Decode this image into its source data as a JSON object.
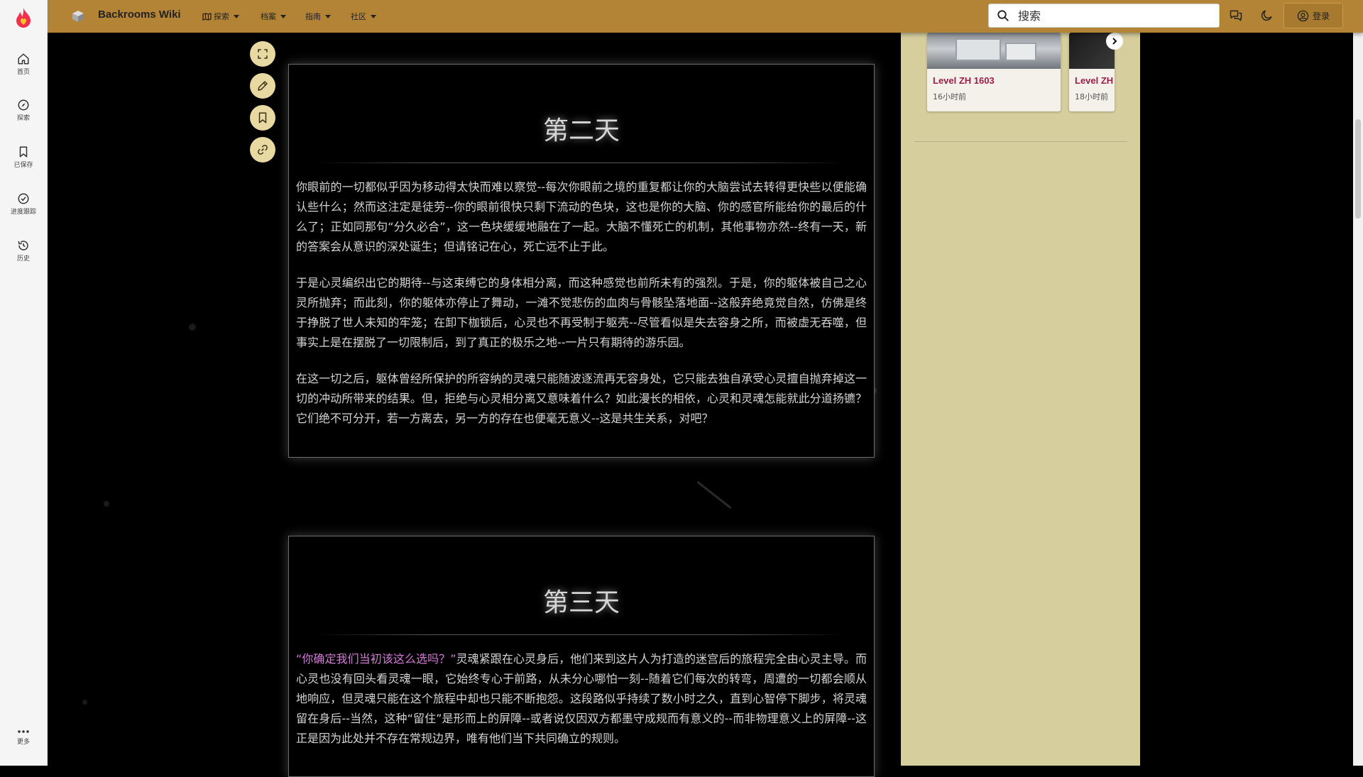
{
  "rail": {
    "items": [
      {
        "label": "首页",
        "icon": "home-icon"
      },
      {
        "label": "探索",
        "icon": "compass-icon"
      },
      {
        "label": "已保存",
        "icon": "bookmark-icon"
      },
      {
        "label": "进度跟踪",
        "icon": "check-circle-icon"
      },
      {
        "label": "历史",
        "icon": "history-icon"
      }
    ],
    "more_label": "更多"
  },
  "topbar": {
    "site_name": "Backrooms Wiki",
    "nav": [
      {
        "label": "探索"
      },
      {
        "label": "档案"
      },
      {
        "label": "指南"
      },
      {
        "label": "社区"
      }
    ],
    "search_placeholder": "搜索",
    "login_label": "登录"
  },
  "article": {
    "day2": {
      "title": "第二天",
      "paragraphs": [
        "你眼前的一切都似乎因为移动得太快而难以察觉--每次你眼前之境的重复都让你的大脑尝试去转得更快些以便能确认些什么；然而这注定是徒劳--你的眼前很快只剩下流动的色块，这也是你的大脑、你的感官所能给你的最后的什么了；正如同那句“分久必合”，这一色块缓缓地融在了一起。大脑不懂死亡的机制，其他事物亦然--终有一天，新的答案会从意识的深处诞生；但请铭记在心，死亡远不止于此。",
        "于是心灵编织出它的期待--与这束缚它的身体相分离，而这种感觉也前所未有的强烈。于是，你的躯体被自己之心灵所抛弃；而此刻，你的躯体亦停止了舞动，一滩不觉悲伤的血肉与骨骸坠落地面--这般弃绝竟觉自然，仿佛是终于挣脱了世人未知的牢笼；在卸下枷锁后，心灵也不再受制于躯壳--尽管看似是失去容身之所，而被虚无吞噬，但事实上是在摆脱了一切限制后，到了真正的极乐之地--一片只有期待的游乐园。",
        "在这一切之后，躯体曾经所保护的所容纳的灵魂只能随波逐流再无容身处，它只能去独自承受心灵擅自抛弃掉这一切的冲动所带来的结果。但，拒绝与心灵相分离又意味着什么？如此漫长的相依，心灵和灵魂怎能就此分道扬镳？它们绝不可分开，若一方离去，另一方的存在也便毫无意义--这是共生关系，对吧？"
      ]
    },
    "day3": {
      "title": "第三天",
      "quote": "“你确定我们当初该这么选吗？”",
      "paragraph_rest": "灵魂紧跟在心灵身后，他们来到这片人为打造的迷宫后的旅程完全由心灵主导。而心灵也没有回头看灵魂一眼，它始终专心于前路，从未分心哪怕一刻--随着它们每次的转弯，周遭的一切都会顺从地响应，但灵魂只能在这个旅程中却也只能不断抱怨。这段路似乎持续了数小时之久，直到心智停下脚步，将灵魂留在身后--当然，这种“留住”是形而上的屏障--或者说仅因双方都墨守成规而有意义的--而非物理意义上的屏障--这正是因为此处并不存在常规边界，唯有他们当下共同确立的规则。"
    }
  },
  "sidebar": {
    "cards": [
      {
        "title": "Level ZH 1603",
        "time": "16小时前"
      },
      {
        "title": "Level ZH",
        "time": "18小时前"
      }
    ]
  },
  "colors": {
    "topbar": "#b48436",
    "sidebar": "#d6ce9d",
    "card_title": "#9b1d4a",
    "quote": "#d67ad8",
    "tool_button": "#e8d9a2"
  }
}
